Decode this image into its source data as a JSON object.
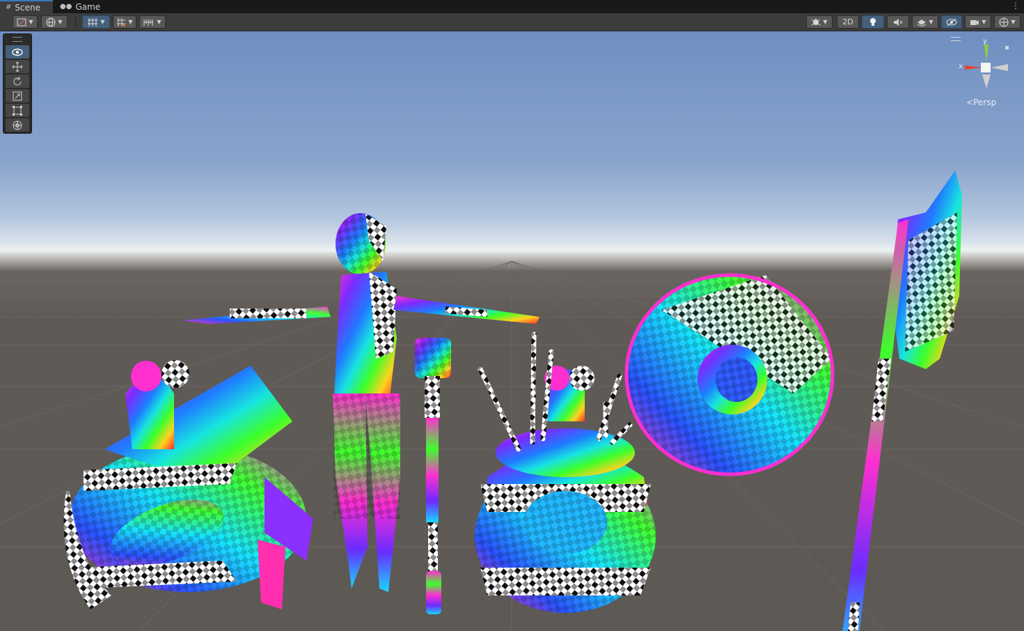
{
  "tabs": [
    {
      "label": "Scene",
      "icon": "hash-grid-icon",
      "active": true
    },
    {
      "label": "Game",
      "icon": "gamepad-icon",
      "active": false
    }
  ],
  "toolbar": {
    "mode_2d_label": "2D"
  },
  "tools": [
    {
      "name": "view-tool",
      "icon": "eye-icon",
      "active": true
    },
    {
      "name": "move-tool",
      "icon": "move-arrows-icon",
      "active": false
    },
    {
      "name": "rotate-tool",
      "icon": "rotate-icon",
      "active": false
    },
    {
      "name": "scale-tool",
      "icon": "scale-icon",
      "active": false
    },
    {
      "name": "rect-tool",
      "icon": "rect-icon",
      "active": false
    },
    {
      "name": "transform-tool",
      "icon": "transform-icon",
      "active": false
    }
  ],
  "gizmo": {
    "y_label": "y",
    "x_label": "x",
    "projection_label": "Persp"
  },
  "colors": {
    "tab_active_accent": "#3a79bb",
    "toolbar_bg": "#3c3c3c",
    "button_on": "#46607c",
    "sky_top": "#6f8fc1",
    "ground": "#5d5955",
    "axis_x": "#e0462e",
    "axis_y": "#8fd13a",
    "axis_z": "#4a7de0"
  }
}
